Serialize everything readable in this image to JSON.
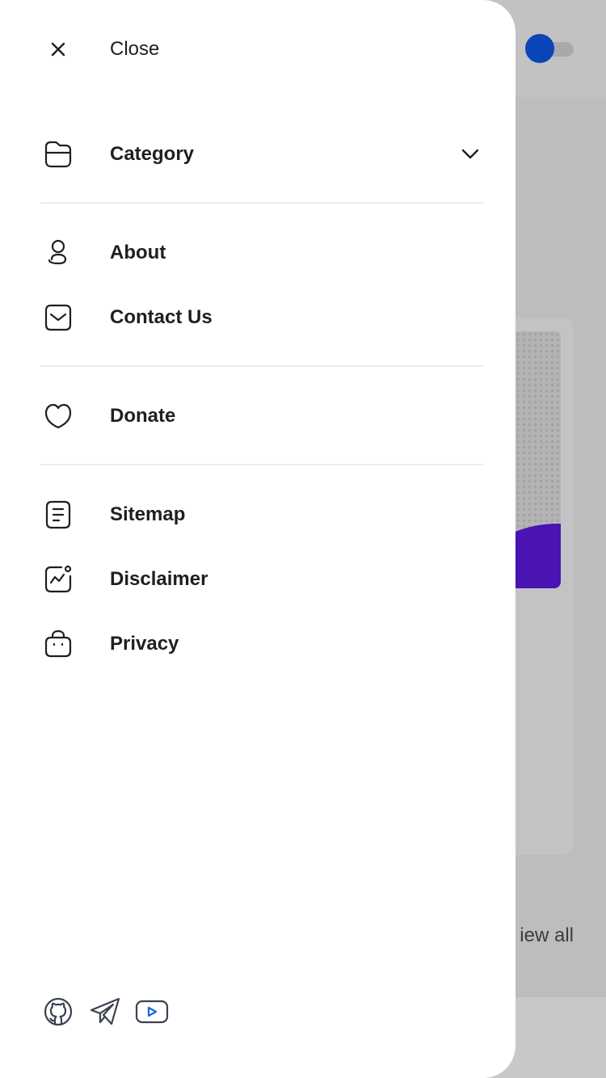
{
  "drawer": {
    "close_label": "Close",
    "menu": {
      "category": "Category",
      "about": "About",
      "contact": "Contact Us",
      "donate": "Donate",
      "sitemap": "Sitemap",
      "disclaimer": "Disclaimer",
      "privacy": "Privacy"
    },
    "social_icons": [
      "github-icon",
      "telegram-icon",
      "youtube-icon"
    ]
  },
  "background": {
    "view_all_label": "iew all",
    "theme_toggle_color": "#0a45b8"
  },
  "colors": {
    "text": "#1f1f23",
    "divider": "#ececee",
    "accent": "#0a45b8",
    "youtube_play": "#1565d8"
  }
}
